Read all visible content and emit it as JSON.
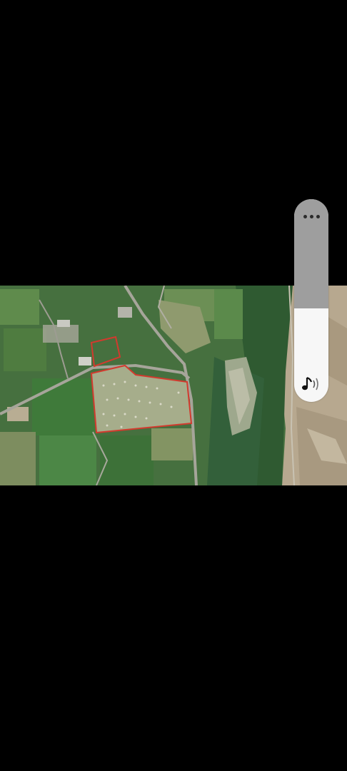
{
  "screen": {
    "background": "#000000"
  },
  "media": {
    "kind": "satellite-image",
    "boundary_color": "#d23a2e"
  },
  "volume_hud": {
    "level_percent": 46,
    "more_icon": "more-dots-icon",
    "sound_icon": "music-note-sound-icon",
    "track_color": "#9e9e9e",
    "fill_color": "#f7f7f7"
  }
}
